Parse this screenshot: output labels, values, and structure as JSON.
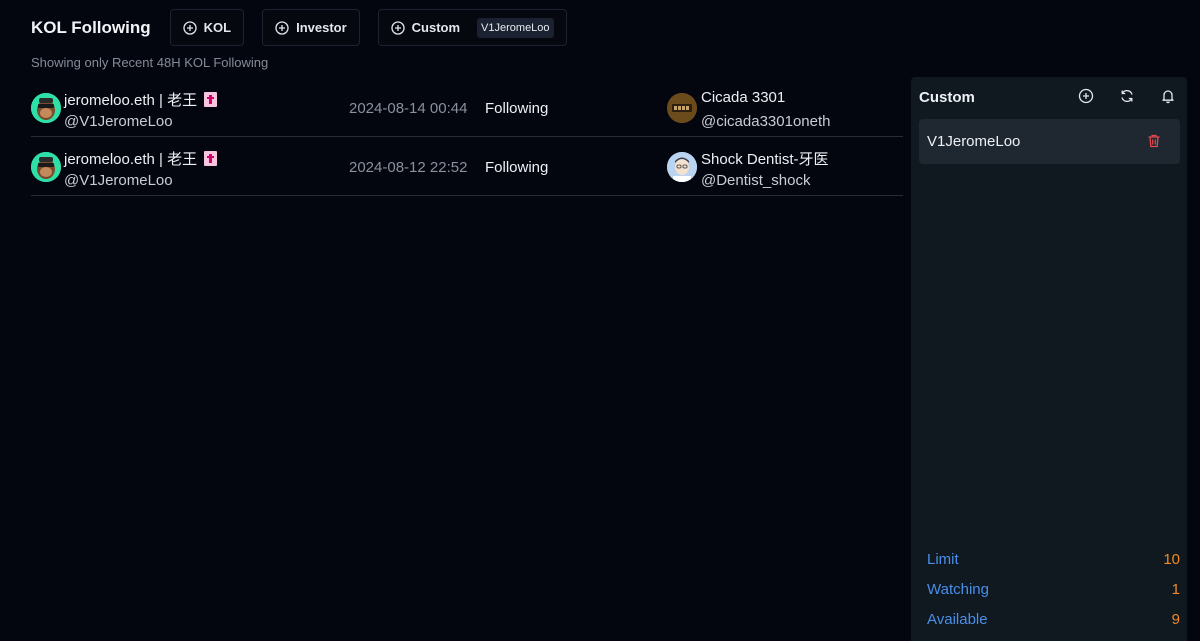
{
  "header": {
    "title": "KOL Following",
    "buttons": [
      {
        "label": "KOL"
      },
      {
        "label": "Investor"
      },
      {
        "label": "Custom",
        "tag": "V1JeromeLoo"
      }
    ],
    "subtitle": "Showing only Recent 48H KOL Following"
  },
  "rows": [
    {
      "source_name": "jeromeloo.eth | 老王",
      "source_handle": "@V1JeromeLoo",
      "time": "2024-08-14 00:44",
      "action": "Following",
      "target_name": "Cicada 3301",
      "target_handle": "@cicada3301oneth"
    },
    {
      "source_name": "jeromeloo.eth | 老王",
      "source_handle": "@V1JeromeLoo",
      "time": "2024-08-12 22:52",
      "action": "Following",
      "target_name": "Shock Dentist-牙医",
      "target_handle": "@Dentist_shock"
    }
  ],
  "panel": {
    "title": "Custom",
    "icons": [
      "plus-circle-icon",
      "refresh-icon",
      "bell-icon"
    ],
    "items": [
      {
        "name": "V1JeromeLoo"
      }
    ],
    "stats": [
      {
        "label": "Limit",
        "value": "10"
      },
      {
        "label": "Watching",
        "value": "1"
      },
      {
        "label": "Available",
        "value": "9"
      }
    ]
  },
  "colors": {
    "background": "#03060f",
    "panel": "#101820",
    "stat_label": "#4a8ee8",
    "stat_value": "#f08a24",
    "trash": "#e5484d"
  }
}
